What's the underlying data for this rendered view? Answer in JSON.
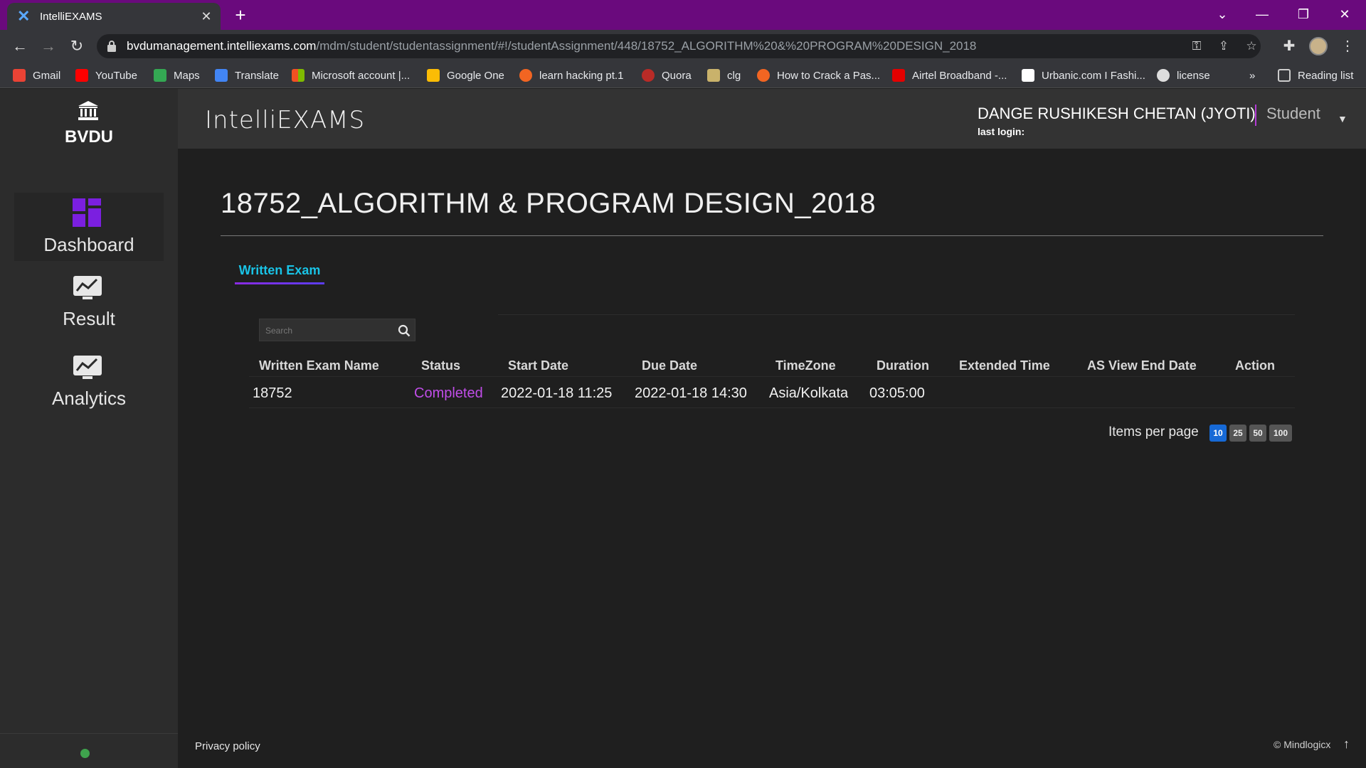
{
  "browser": {
    "tab_title": "IntelliEXAMS",
    "url_host": "bvdumanagement.intelliexams.com",
    "url_path": "/mdm/student/studentassignment/#!/studentAssignment/448/18752_ALGORITHM%20&%20PROGRAM%20DESIGN_2018",
    "bookmarks": [
      {
        "label": "Gmail",
        "color": "#ea4335"
      },
      {
        "label": "YouTube",
        "color": "#ff0000"
      },
      {
        "label": "Maps",
        "color": "#34a853"
      },
      {
        "label": "Translate",
        "color": "#4285f4"
      },
      {
        "label": "Microsoft account |...",
        "color": "#f25022"
      },
      {
        "label": "Google One",
        "color": "#fbbc05"
      },
      {
        "label": "learn  hacking pt.1",
        "color": "#f26522"
      },
      {
        "label": "Quora",
        "color": "#b92b27"
      },
      {
        "label": "clg",
        "color": "#c9b26b"
      },
      {
        "label": "How to Crack a Pas...",
        "color": "#f26522"
      },
      {
        "label": "Airtel Broadband -...",
        "color": "#e40000"
      },
      {
        "label": "Urbanic.com I Fashi...",
        "color": "#ffffff"
      },
      {
        "label": "license",
        "color": "#dddddd"
      }
    ],
    "reading_list": "Reading list",
    "overflow": "»"
  },
  "sidebar": {
    "brand": "BVDU",
    "items": [
      {
        "label": "Dashboard",
        "icon": "dashboard-icon"
      },
      {
        "label": "Result",
        "icon": "chart-icon"
      },
      {
        "label": "Analytics",
        "icon": "chart-icon"
      }
    ]
  },
  "header": {
    "logo": "IntelliEXAMS",
    "user_name": "DANGE RUSHIKESH CHETAN (JYOTI)",
    "role": "Student",
    "last_login": "last login:"
  },
  "main": {
    "title": "18752_ALGORITHM & PROGRAM DESIGN_2018",
    "tab": "Written Exam",
    "search_placeholder": "Search",
    "columns": [
      "Written Exam Name",
      "Status",
      "Start Date",
      "Due Date",
      "TimeZone",
      "Duration",
      "Extended Time",
      "AS View End Date",
      "Action"
    ],
    "rows": [
      {
        "name": "18752",
        "status": "Completed",
        "start": "2022-01-18 11:25",
        "due": "2022-01-18 14:30",
        "timezone": "Asia/Kolkata",
        "duration": "03:05:00"
      }
    ],
    "items_per_page_label": "Items per page",
    "page_sizes": [
      "10",
      "25",
      "50",
      "100"
    ],
    "active_page_size": "10"
  },
  "footer": {
    "privacy": "Privacy policy",
    "copyright": "© Mindlogicx"
  },
  "colors": {
    "accent_purple": "#6a0a7d",
    "status_completed": "#c04de8",
    "tab_text": "#19c3e6",
    "active_page": "#1669d6"
  }
}
